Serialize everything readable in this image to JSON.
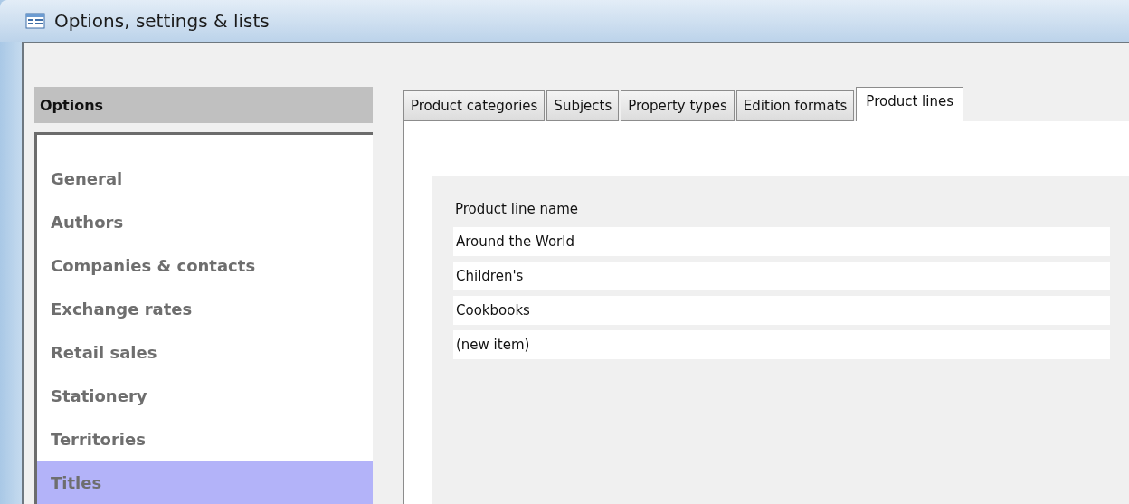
{
  "window": {
    "title": "Options, settings & lists"
  },
  "sidebar": {
    "header": "Options",
    "items": [
      {
        "label": "General",
        "selected": false
      },
      {
        "label": "Authors",
        "selected": false
      },
      {
        "label": "Companies & contacts",
        "selected": false
      },
      {
        "label": "Exchange rates",
        "selected": false
      },
      {
        "label": "Retail sales",
        "selected": false
      },
      {
        "label": "Stationery",
        "selected": false
      },
      {
        "label": "Territories",
        "selected": false
      },
      {
        "label": "Titles",
        "selected": true
      }
    ]
  },
  "tabs": [
    {
      "label": "Product categories",
      "selected": false
    },
    {
      "label": "Subjects",
      "selected": false
    },
    {
      "label": "Property types",
      "selected": false
    },
    {
      "label": "Edition formats",
      "selected": false
    },
    {
      "label": "Product lines",
      "selected": true
    }
  ],
  "table": {
    "columns": [
      "Product line name"
    ],
    "rows": [
      "Around the World",
      "Children's",
      "Cookbooks",
      "(new item)"
    ]
  }
}
